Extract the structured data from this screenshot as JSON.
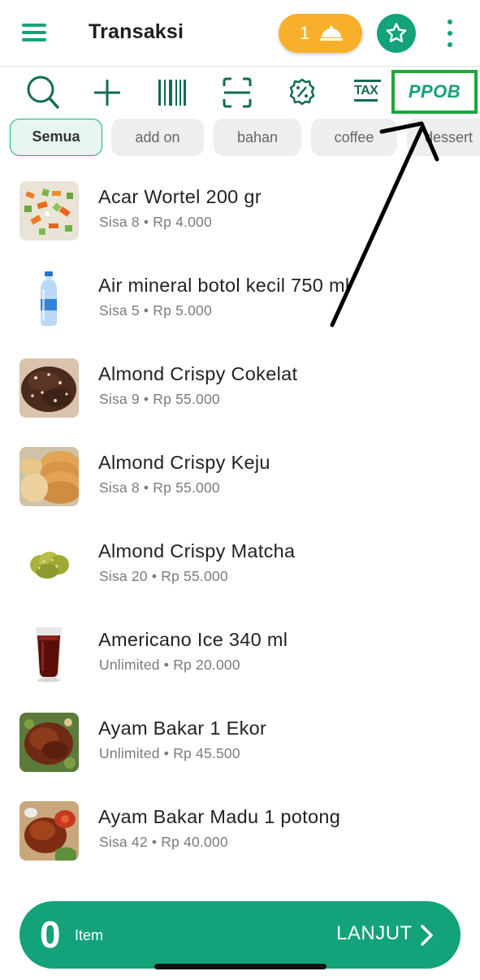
{
  "appbar": {
    "title": "Transaksi",
    "order_count": "1"
  },
  "toolbar": {
    "items": [
      {
        "name": "search-icon"
      },
      {
        "name": "plus-icon"
      },
      {
        "name": "barcode-icon"
      },
      {
        "name": "scan-icon"
      },
      {
        "name": "discount-icon"
      },
      {
        "name": "tax-icon",
        "label": "TAX"
      },
      {
        "name": "ppob-icon",
        "label": "PPOB"
      }
    ]
  },
  "categories": [
    {
      "label": "Semua",
      "active": true
    },
    {
      "label": "add on"
    },
    {
      "label": "bahan"
    },
    {
      "label": "coffee"
    },
    {
      "label": "dessert"
    }
  ],
  "products": [
    {
      "name": "Acar Wortel 200 gr",
      "meta": "Sisa 8 • Rp 4.000"
    },
    {
      "name": "Air mineral botol kecil 750 ml",
      "meta": "Sisa 5 • Rp 5.000"
    },
    {
      "name": "Almond Crispy Cokelat",
      "meta": "Sisa 9 • Rp 55.000"
    },
    {
      "name": "Almond Crispy Keju",
      "meta": "Sisa 8 • Rp 55.000"
    },
    {
      "name": "Almond Crispy Matcha",
      "meta": "Sisa 20 • Rp 55.000"
    },
    {
      "name": "Americano Ice 340 ml",
      "meta": "Unlimited • Rp 20.000"
    },
    {
      "name": "Ayam Bakar 1 Ekor",
      "meta": "Unlimited • Rp 45.500"
    },
    {
      "name": "Ayam Bakar Madu 1 potong",
      "meta": "Sisa 42 • Rp 40.000"
    }
  ],
  "cart": {
    "count": "0",
    "unit_label": "Item",
    "next_label": "LANJUT"
  },
  "colors": {
    "primary": "#13a27a",
    "accent": "#f8b02a",
    "highlight": "#1ba83e"
  }
}
